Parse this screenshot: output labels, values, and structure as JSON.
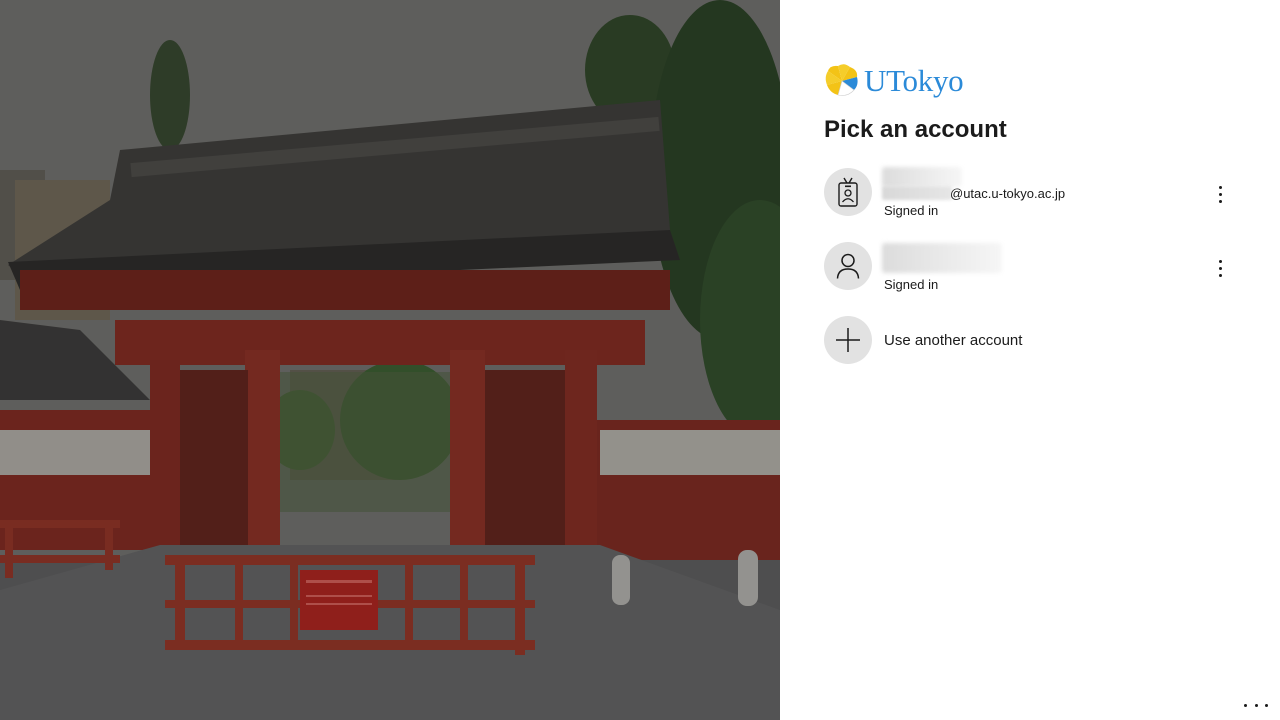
{
  "brand": {
    "logo_text": "UTokyo",
    "logo_color": "#2b8ad8",
    "mark_color": "#f3c316"
  },
  "title": "Pick an account",
  "accounts": [
    {
      "icon": "badge-icon",
      "email_suffix": "@utac.u-tokyo.ac.jp",
      "status": "Signed in"
    },
    {
      "icon": "person-icon",
      "status": "Signed in"
    }
  ],
  "add_account": {
    "icon": "plus-icon",
    "label": "Use another account"
  },
  "background": {
    "description_icon": "red-gate-photo"
  }
}
